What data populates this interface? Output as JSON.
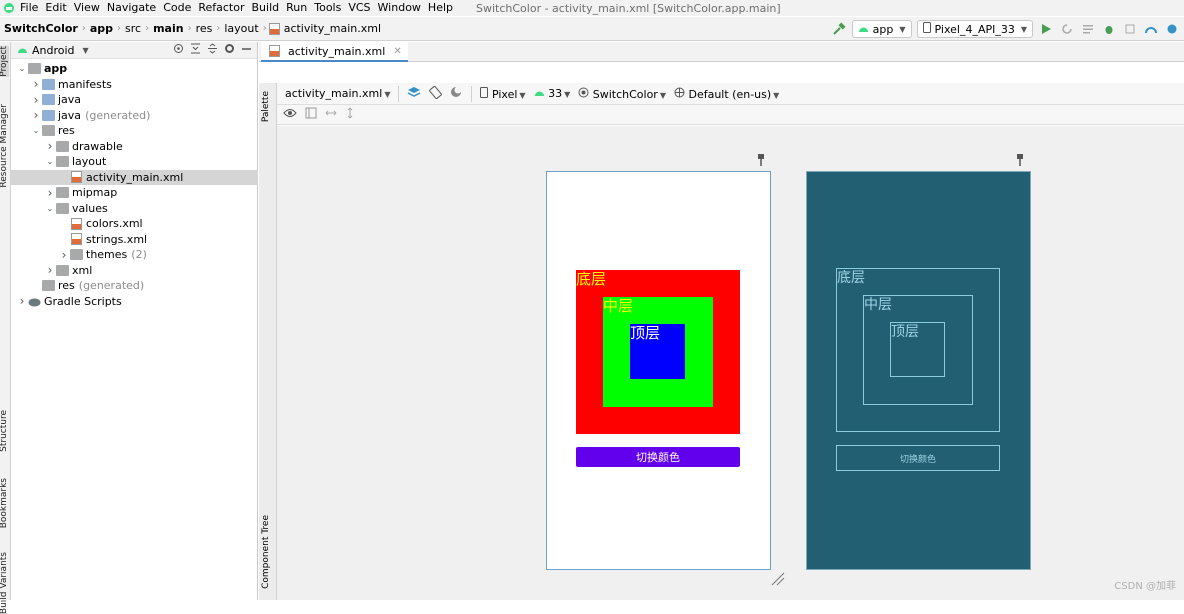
{
  "menu": {
    "items": [
      "File",
      "Edit",
      "View",
      "Navigate",
      "Code",
      "Refactor",
      "Build",
      "Run",
      "Tools",
      "VCS",
      "Window",
      "Help"
    ],
    "window_title": "SwitchColor - activity_main.xml [SwitchColor.app.main]"
  },
  "breadcrumb": [
    "SwitchColor",
    "app",
    "src",
    "main",
    "res",
    "layout",
    "activity_main.xml"
  ],
  "run_config": {
    "module": "app",
    "device": "Pixel_4_API_33"
  },
  "left_strip": {
    "tabs": [
      "Project",
      "Resource Manager",
      "Structure",
      "Bookmarks",
      "Build Variants"
    ]
  },
  "project_panel": {
    "view": "Android",
    "tree": [
      {
        "label": "app",
        "depth": 0,
        "arrow": "down",
        "icon": "module",
        "bold": true
      },
      {
        "label": "manifests",
        "depth": 1,
        "arrow": "right",
        "icon": "folder"
      },
      {
        "label": "java",
        "depth": 1,
        "arrow": "right",
        "icon": "folder"
      },
      {
        "label": "java",
        "suffix": "(generated)",
        "depth": 1,
        "arrow": "right",
        "icon": "folder"
      },
      {
        "label": "res",
        "depth": 1,
        "arrow": "down",
        "icon": "folder-grey"
      },
      {
        "label": "drawable",
        "depth": 2,
        "arrow": "right",
        "icon": "folder-grey"
      },
      {
        "label": "layout",
        "depth": 2,
        "arrow": "down",
        "icon": "folder-grey"
      },
      {
        "label": "activity_main.xml",
        "depth": 3,
        "arrow": "",
        "icon": "xml",
        "selected": true
      },
      {
        "label": "mipmap",
        "depth": 2,
        "arrow": "right",
        "icon": "folder-grey"
      },
      {
        "label": "values",
        "depth": 2,
        "arrow": "down",
        "icon": "folder-grey"
      },
      {
        "label": "colors.xml",
        "depth": 3,
        "arrow": "",
        "icon": "xml"
      },
      {
        "label": "strings.xml",
        "depth": 3,
        "arrow": "",
        "icon": "xml"
      },
      {
        "label": "themes",
        "suffix": "(2)",
        "depth": 3,
        "arrow": "right",
        "icon": "folder-grey"
      },
      {
        "label": "xml",
        "depth": 2,
        "arrow": "right",
        "icon": "folder-grey"
      },
      {
        "label": "res",
        "suffix": "(generated)",
        "depth": 1,
        "arrow": "",
        "icon": "folder-grey"
      },
      {
        "label": "Gradle Scripts",
        "depth": 0,
        "arrow": "right",
        "icon": "gradle"
      }
    ]
  },
  "editor": {
    "tab": "activity_main.xml",
    "side_tabs": [
      "Palette",
      "Component Tree"
    ],
    "toolbar": {
      "file": "activity_main.xml",
      "device": "Pixel",
      "api": "33",
      "theme": "SwitchColor",
      "locale": "Default (en-us)"
    }
  },
  "design": {
    "layers": {
      "bottom": {
        "label": "底层",
        "bg": "#ff0000",
        "text_color": "#ffff00"
      },
      "middle": {
        "label": "中层",
        "bg": "#00ff00",
        "text_color": "#ffff00"
      },
      "top": {
        "label": "顶层",
        "bg": "#0000ff",
        "text_color": "#ffffff"
      }
    },
    "button": {
      "label": "切换颜色",
      "bg": "#6200ee"
    }
  },
  "blueprint": {
    "bg": "#235f73",
    "layers": [
      "底层",
      "中层",
      "顶层"
    ],
    "button": "切换颜色"
  },
  "watermark": "CSDN @加菲"
}
